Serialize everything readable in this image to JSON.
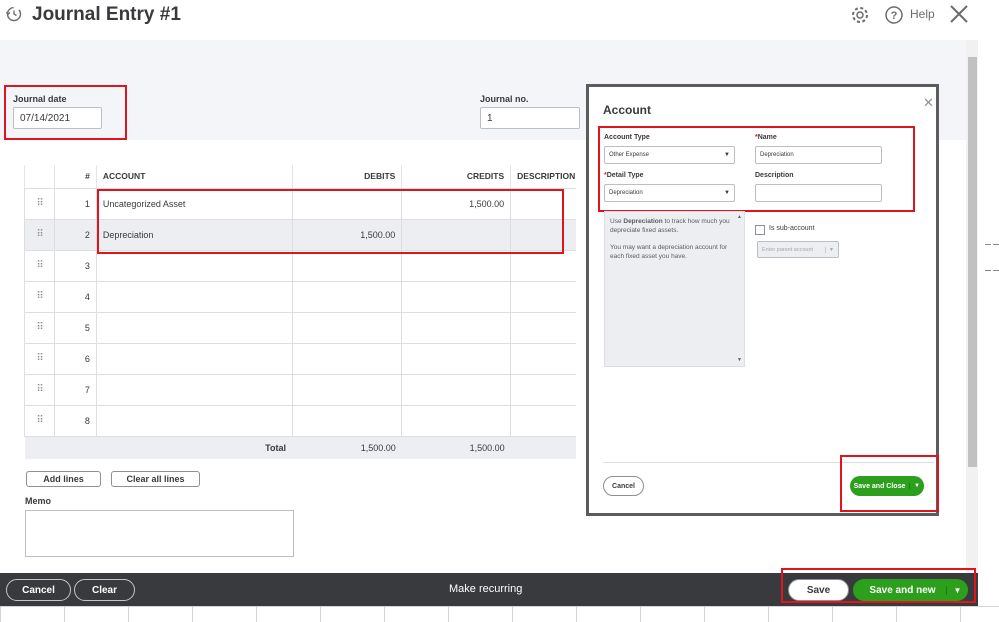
{
  "header": {
    "title": "Journal Entry #1",
    "help_label": "Help"
  },
  "form": {
    "journal_date_label": "Journal date",
    "journal_date_value": "07/14/2021",
    "journal_no_label": "Journal no.",
    "journal_no_value": "1"
  },
  "table": {
    "columns": [
      "#",
      "ACCOUNT",
      "DEBITS",
      "CREDITS",
      "DESCRIPTION"
    ],
    "rows": [
      {
        "num": "1",
        "account": "Uncategorized Asset",
        "debits": "",
        "credits": "1,500.00",
        "description": ""
      },
      {
        "num": "2",
        "account": "Depreciation",
        "debits": "1,500.00",
        "credits": "",
        "description": ""
      },
      {
        "num": "3",
        "account": "",
        "debits": "",
        "credits": "",
        "description": ""
      },
      {
        "num": "4",
        "account": "",
        "debits": "",
        "credits": "",
        "description": ""
      },
      {
        "num": "5",
        "account": "",
        "debits": "",
        "credits": "",
        "description": ""
      },
      {
        "num": "6",
        "account": "",
        "debits": "",
        "credits": "",
        "description": ""
      },
      {
        "num": "7",
        "account": "",
        "debits": "",
        "credits": "",
        "description": ""
      },
      {
        "num": "8",
        "account": "",
        "debits": "",
        "credits": "",
        "description": ""
      }
    ],
    "total_label": "Total",
    "total_debits": "1,500.00",
    "total_credits": "1,500.00"
  },
  "actions": {
    "add_lines": "Add lines",
    "clear_all_lines": "Clear all lines",
    "memo_label": "Memo"
  },
  "footer": {
    "cancel": "Cancel",
    "clear": "Clear",
    "make_recurring": "Make recurring",
    "save": "Save",
    "save_and_new": "Save and new"
  },
  "modal": {
    "title": "Account",
    "account_type_label": "Account Type",
    "account_type_value": "Other Expense",
    "name_label": "Name",
    "name_value": "Depreciation",
    "detail_type_label": "Detail Type",
    "detail_type_value": "Depreciation",
    "description_label": "Description",
    "help_text_strong": "Depreciation",
    "help_text_1_pre": "Use ",
    "help_text_1_post": " to track how much you depreciate fixed assets.",
    "help_text_2": "You may want a depreciation account for each fixed asset you have.",
    "sub_account_label": "Is sub-account",
    "parent_placeholder": "Enter parent account",
    "cancel": "Cancel",
    "save_and_close": "Save and Close"
  },
  "colors": {
    "accent_green": "#2ca01c",
    "highlight_red": "#e0141e",
    "footer_dark": "#393a3d"
  }
}
